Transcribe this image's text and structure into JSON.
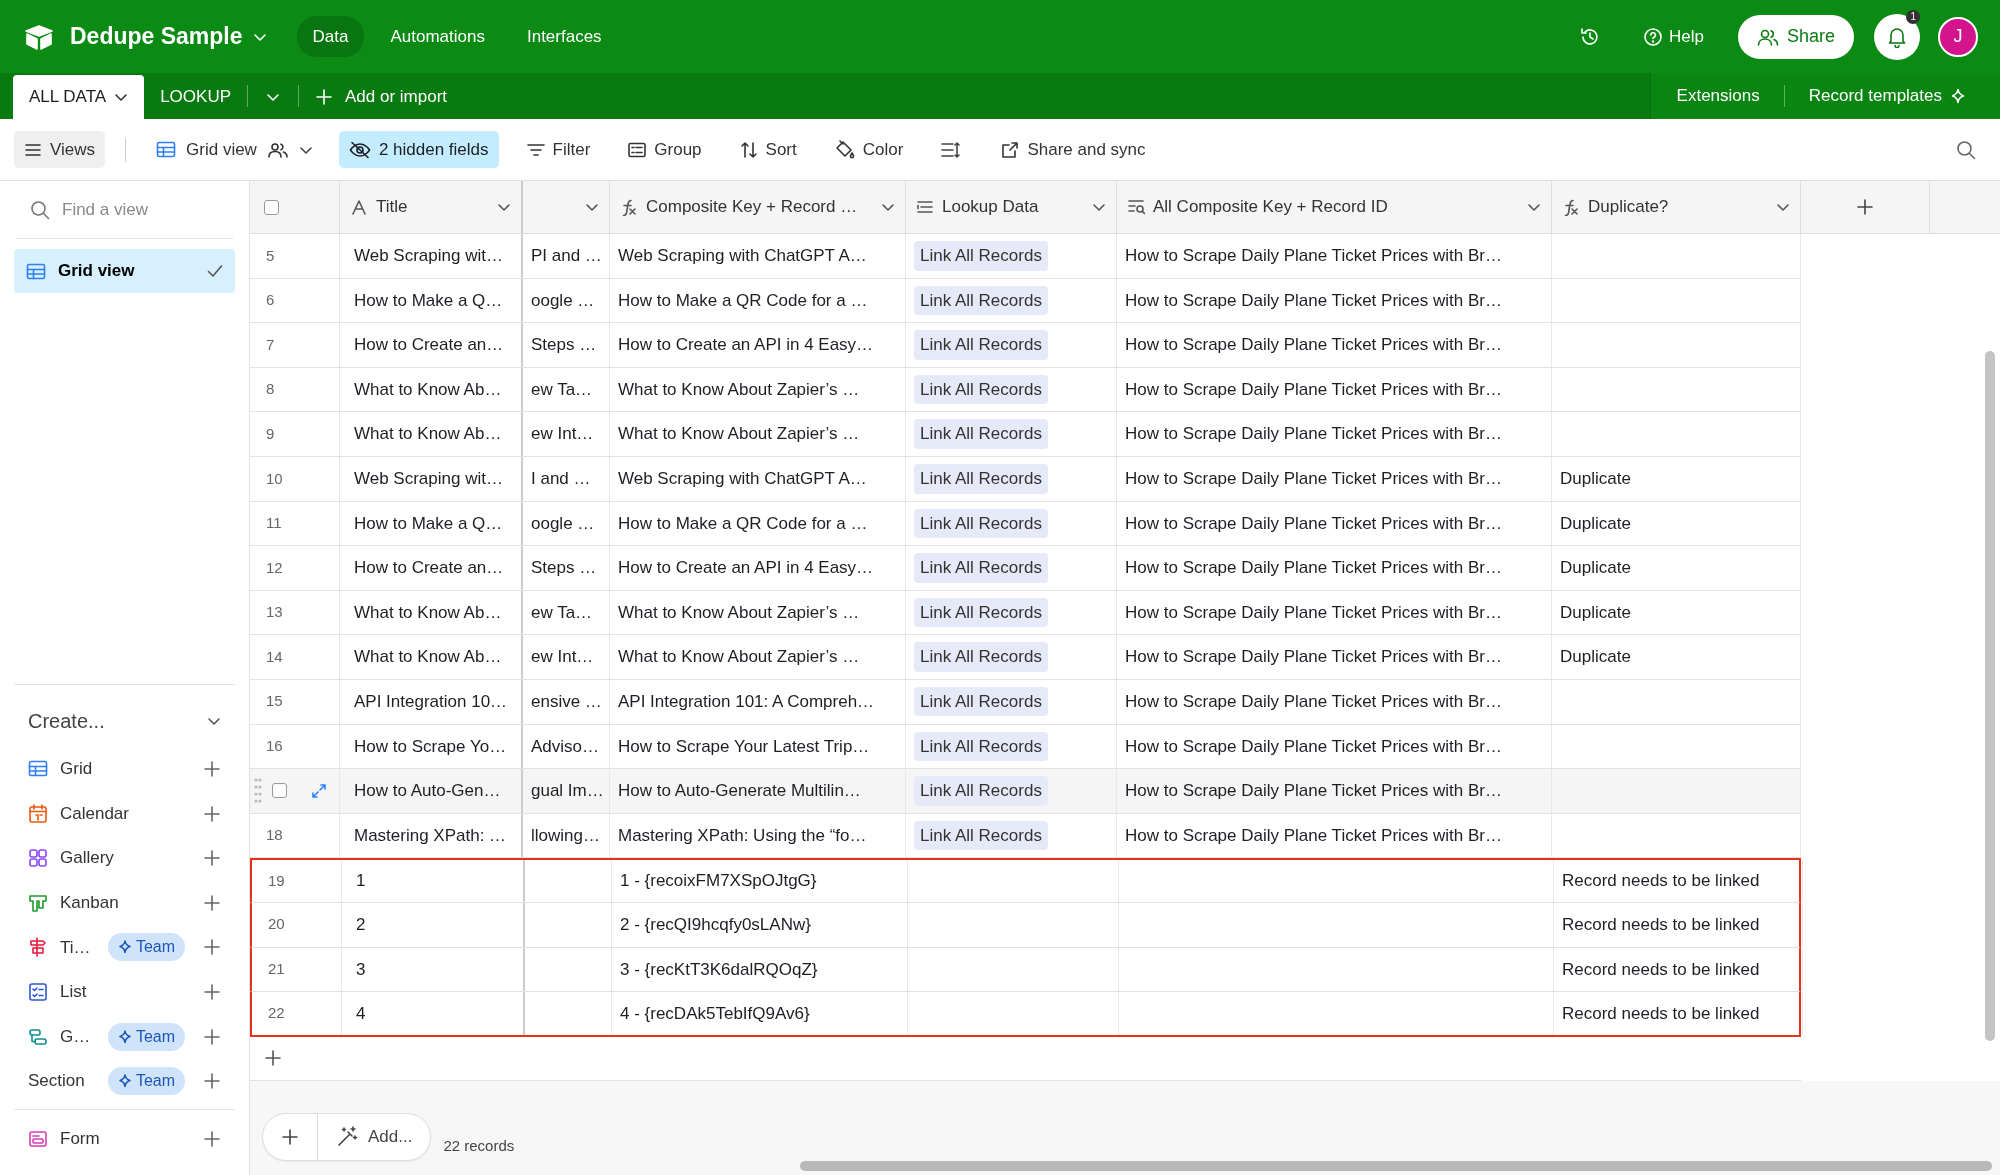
{
  "app_bar": {
    "title": "Dedupe Sample",
    "nav": [
      {
        "label": "Data",
        "selected": true
      },
      {
        "label": "Automations",
        "selected": false
      },
      {
        "label": "Interfaces",
        "selected": false
      }
    ],
    "help": "Help",
    "share": "Share",
    "notification_count": "1",
    "avatar": "J"
  },
  "table_tabs": {
    "tabs": [
      {
        "label": "ALL DATA",
        "selected": true
      },
      {
        "label": "LOOKUP",
        "selected": false
      }
    ],
    "add": "Add or import",
    "extensions": "Extensions",
    "record_templates": "Record templates"
  },
  "view_bar": {
    "views": "Views",
    "view_name": "Grid view",
    "hidden_fields": "2 hidden fields",
    "tools": [
      {
        "kind": "filter",
        "label": "Filter"
      },
      {
        "kind": "group",
        "label": "Group"
      },
      {
        "kind": "sort",
        "label": "Sort"
      },
      {
        "kind": "color",
        "label": "Color"
      },
      {
        "kind": "row-height"
      },
      {
        "kind": "share",
        "label": "Share and sync"
      }
    ]
  },
  "sidebar": {
    "search": {
      "placeholder": "Find a view"
    },
    "views": [
      {
        "label": "Grid view",
        "selected": true
      }
    ],
    "create_label": "Create...",
    "create_items": [
      {
        "kind": "grid",
        "label": "Grid"
      },
      {
        "kind": "calendar",
        "label": "Calendar"
      },
      {
        "kind": "gallery",
        "label": "Gallery"
      },
      {
        "kind": "kanban",
        "label": "Kanban"
      },
      {
        "kind": "timeline",
        "label": "Ti…",
        "badge": "Team"
      },
      {
        "kind": "list",
        "label": "List"
      },
      {
        "kind": "gantt",
        "label": "G…",
        "badge": "Team"
      },
      {
        "kind": "section",
        "label": "Section",
        "badge": "Team"
      },
      {
        "kind": "divider"
      },
      {
        "kind": "form",
        "label": "Form"
      }
    ]
  },
  "grid": {
    "select_all": {
      "checked": false
    },
    "columns": [
      {
        "kind": "text",
        "label": "Title"
      },
      {
        "kind": "cut"
      },
      {
        "kind": "formula",
        "label": "Composite Key + Record …"
      },
      {
        "kind": "lookup",
        "label": "Lookup Data"
      },
      {
        "kind": "rollup",
        "label": "All Composite Key + Record ID"
      },
      {
        "kind": "formula",
        "label": "Duplicate?"
      }
    ],
    "rows": [
      {
        "number": "5",
        "hovered": false,
        "outlined": false,
        "cells": [
          "Web Scraping wit…",
          "PI and …",
          "Web Scraping with ChatGPT A…",
          "Link All Records",
          "How to Scrape Daily Plane Ticket Prices with Br…",
          null
        ]
      },
      {
        "number": "6",
        "hovered": false,
        "outlined": false,
        "cells": [
          "How to Make a Q…",
          "oogle …",
          "How to Make a QR Code for a …",
          "Link All Records",
          "How to Scrape Daily Plane Ticket Prices with Br…",
          null
        ]
      },
      {
        "number": "7",
        "hovered": false,
        "outlined": false,
        "cells": [
          "How to Create an…",
          "Steps …",
          "How to Create an API in 4 Easy…",
          "Link All Records",
          "How to Scrape Daily Plane Ticket Prices with Br…",
          null
        ]
      },
      {
        "number": "8",
        "hovered": false,
        "outlined": false,
        "cells": [
          "What to Know Ab…",
          "ew Ta…",
          "What to Know About Zapier’s …",
          "Link All Records",
          "How to Scrape Daily Plane Ticket Prices with Br…",
          null
        ]
      },
      {
        "number": "9",
        "hovered": false,
        "outlined": false,
        "cells": [
          "What to Know Ab…",
          "ew Int…",
          "What to Know About Zapier’s …",
          "Link All Records",
          "How to Scrape Daily Plane Ticket Prices with Br…",
          null
        ]
      },
      {
        "number": "10",
        "hovered": false,
        "outlined": false,
        "cells": [
          "Web Scraping wit…",
          "I and …",
          "Web Scraping with ChatGPT A…",
          "Link All Records",
          "How to Scrape Daily Plane Ticket Prices with Br…",
          "Duplicate"
        ]
      },
      {
        "number": "11",
        "hovered": false,
        "outlined": false,
        "cells": [
          "How to Make a Q…",
          "oogle …",
          "How to Make a QR Code for a …",
          "Link All Records",
          "How to Scrape Daily Plane Ticket Prices with Br…",
          "Duplicate"
        ]
      },
      {
        "number": "12",
        "hovered": false,
        "outlined": false,
        "cells": [
          "How to Create an…",
          "Steps …",
          "How to Create an API in 4 Easy…",
          "Link All Records",
          "How to Scrape Daily Plane Ticket Prices with Br…",
          "Duplicate"
        ]
      },
      {
        "number": "13",
        "hovered": false,
        "outlined": false,
        "cells": [
          "What to Know Ab…",
          "ew Ta…",
          "What to Know About Zapier’s …",
          "Link All Records",
          "How to Scrape Daily Plane Ticket Prices with Br…",
          "Duplicate"
        ]
      },
      {
        "number": "14",
        "hovered": false,
        "outlined": false,
        "cells": [
          "What to Know Ab…",
          "ew Int…",
          "What to Know About Zapier’s …",
          "Link All Records",
          "How to Scrape Daily Plane Ticket Prices with Br…",
          "Duplicate"
        ]
      },
      {
        "number": "15",
        "hovered": false,
        "outlined": false,
        "cells": [
          "API Integration 10…",
          "ensive …",
          "API Integration 101: A Compreh…",
          "Link All Records",
          "How to Scrape Daily Plane Ticket Prices with Br…",
          null
        ]
      },
      {
        "number": "16",
        "hovered": false,
        "outlined": false,
        "cells": [
          "How to Scrape Yo…",
          "Adviso…",
          "How to Scrape Your Latest Trip…",
          "Link All Records",
          "How to Scrape Daily Plane Ticket Prices with Br…",
          null
        ]
      },
      {
        "hovered": true,
        "checked": false,
        "outlined": false,
        "cells": [
          "How to Auto-Gen…",
          "gual Im…",
          "How to Auto-Generate Multilin…",
          "Link All Records",
          "How to Scrape Daily Plane Ticket Prices with Br…",
          null
        ]
      },
      {
        "number": "18",
        "hovered": false,
        "outlined": false,
        "cells": [
          "Mastering XPath: …",
          "llowing…",
          "Mastering XPath: Using the “fo…",
          "Link All Records",
          "How to Scrape Daily Plane Ticket Prices with Br…",
          null
        ]
      },
      {
        "number": "19",
        "hovered": false,
        "outlined": true,
        "cells": [
          "1",
          null,
          "1 - {recoixFM7XSpOJtgG}",
          null,
          null,
          "Record needs to be linked"
        ]
      },
      {
        "number": "20",
        "hovered": false,
        "outlined": true,
        "cells": [
          "2",
          null,
          "2 - {recQI9hcqfy0sLANw}",
          null,
          null,
          "Record needs to be linked"
        ]
      },
      {
        "number": "21",
        "hovered": false,
        "outlined": true,
        "cells": [
          "3",
          null,
          "3 - {recKtT3K6dalRQOqZ}",
          null,
          null,
          "Record needs to be linked"
        ]
      },
      {
        "number": "22",
        "hovered": false,
        "outlined": true,
        "cells": [
          "4",
          null,
          "4 - {recDAk5TebIfQ9Av6}",
          null,
          null,
          "Record needs to be linked"
        ]
      }
    ],
    "add_label": "Add...",
    "record_count": "22 records"
  }
}
